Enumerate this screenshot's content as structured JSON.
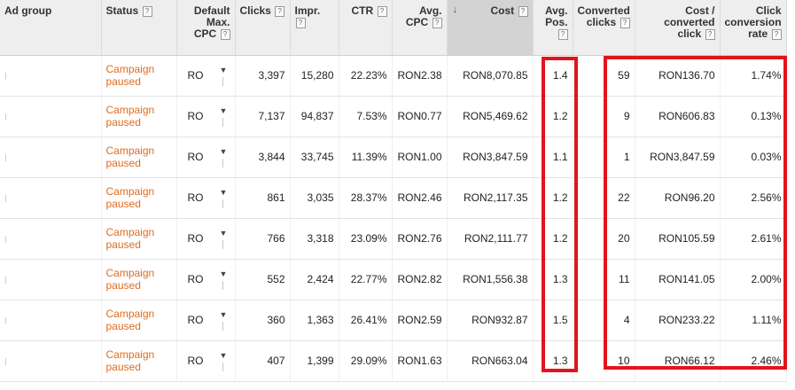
{
  "columns": {
    "ad_group": "Ad group",
    "status": "Status",
    "default_max_cpc": "Default Max. CPC",
    "clicks": "Clicks",
    "impr": "Impr.",
    "ctr": "CTR",
    "avg_cpc": "Avg. CPC",
    "cost": "Cost",
    "avg_pos": "Avg. Pos.",
    "converted_clicks": "Converted clicks",
    "cost_per_converted_click": "Cost / converted click",
    "click_conversion_rate": "Click conversion rate"
  },
  "help_glyph": "?",
  "sort_glyph": "↓",
  "edit_glyph": "▼",
  "rows": [
    {
      "status": "Campaign paused",
      "cpc": "RO",
      "clicks": "3,397",
      "impr": "15,280",
      "ctr": "22.23%",
      "avg_cpc": "RON2.38",
      "cost": "RON8,070.85",
      "avg_pos": "1.4",
      "conv": "59",
      "cost_conv": "RON136.70",
      "conv_rate": "1.74%"
    },
    {
      "status": "Campaign paused",
      "cpc": "RO",
      "clicks": "7,137",
      "impr": "94,837",
      "ctr": "7.53%",
      "avg_cpc": "RON0.77",
      "cost": "RON5,469.62",
      "avg_pos": "1.2",
      "conv": "9",
      "cost_conv": "RON606.83",
      "conv_rate": "0.13%"
    },
    {
      "status": "Campaign paused",
      "cpc": "RO",
      "clicks": "3,844",
      "impr": "33,745",
      "ctr": "11.39%",
      "avg_cpc": "RON1.00",
      "cost": "RON3,847.59",
      "avg_pos": "1.1",
      "conv": "1",
      "cost_conv": "RON3,847.59",
      "conv_rate": "0.03%"
    },
    {
      "status": "Campaign paused",
      "cpc": "RO",
      "clicks": "861",
      "impr": "3,035",
      "ctr": "28.37%",
      "avg_cpc": "RON2.46",
      "cost": "RON2,117.35",
      "avg_pos": "1.2",
      "conv": "22",
      "cost_conv": "RON96.20",
      "conv_rate": "2.56%"
    },
    {
      "status": "Campaign paused",
      "cpc": "RO",
      "clicks": "766",
      "impr": "3,318",
      "ctr": "23.09%",
      "avg_cpc": "RON2.76",
      "cost": "RON2,111.77",
      "avg_pos": "1.2",
      "conv": "20",
      "cost_conv": "RON105.59",
      "conv_rate": "2.61%"
    },
    {
      "status": "Campaign paused",
      "cpc": "RO",
      "clicks": "552",
      "impr": "2,424",
      "ctr": "22.77%",
      "avg_cpc": "RON2.82",
      "cost": "RON1,556.38",
      "avg_pos": "1.3",
      "conv": "11",
      "cost_conv": "RON141.05",
      "conv_rate": "2.00%"
    },
    {
      "status": "Campaign paused",
      "cpc": "RO",
      "clicks": "360",
      "impr": "1,363",
      "ctr": "26.41%",
      "avg_cpc": "RON2.59",
      "cost": "RON932.87",
      "avg_pos": "1.5",
      "conv": "4",
      "cost_conv": "RON233.22",
      "conv_rate": "1.11%"
    },
    {
      "status": "Campaign paused",
      "cpc": "RO",
      "clicks": "407",
      "impr": "1,399",
      "ctr": "29.09%",
      "avg_cpc": "RON1.63",
      "cost": "RON663.04",
      "avg_pos": "1.3",
      "conv": "10",
      "cost_conv": "RON66.12",
      "conv_rate": "2.46%"
    }
  ],
  "colors": {
    "highlight": "#e3141b",
    "status_paused": "#e06c1f",
    "header_bg": "#eeeeee",
    "sorted_header_bg": "#d3d3d3"
  }
}
